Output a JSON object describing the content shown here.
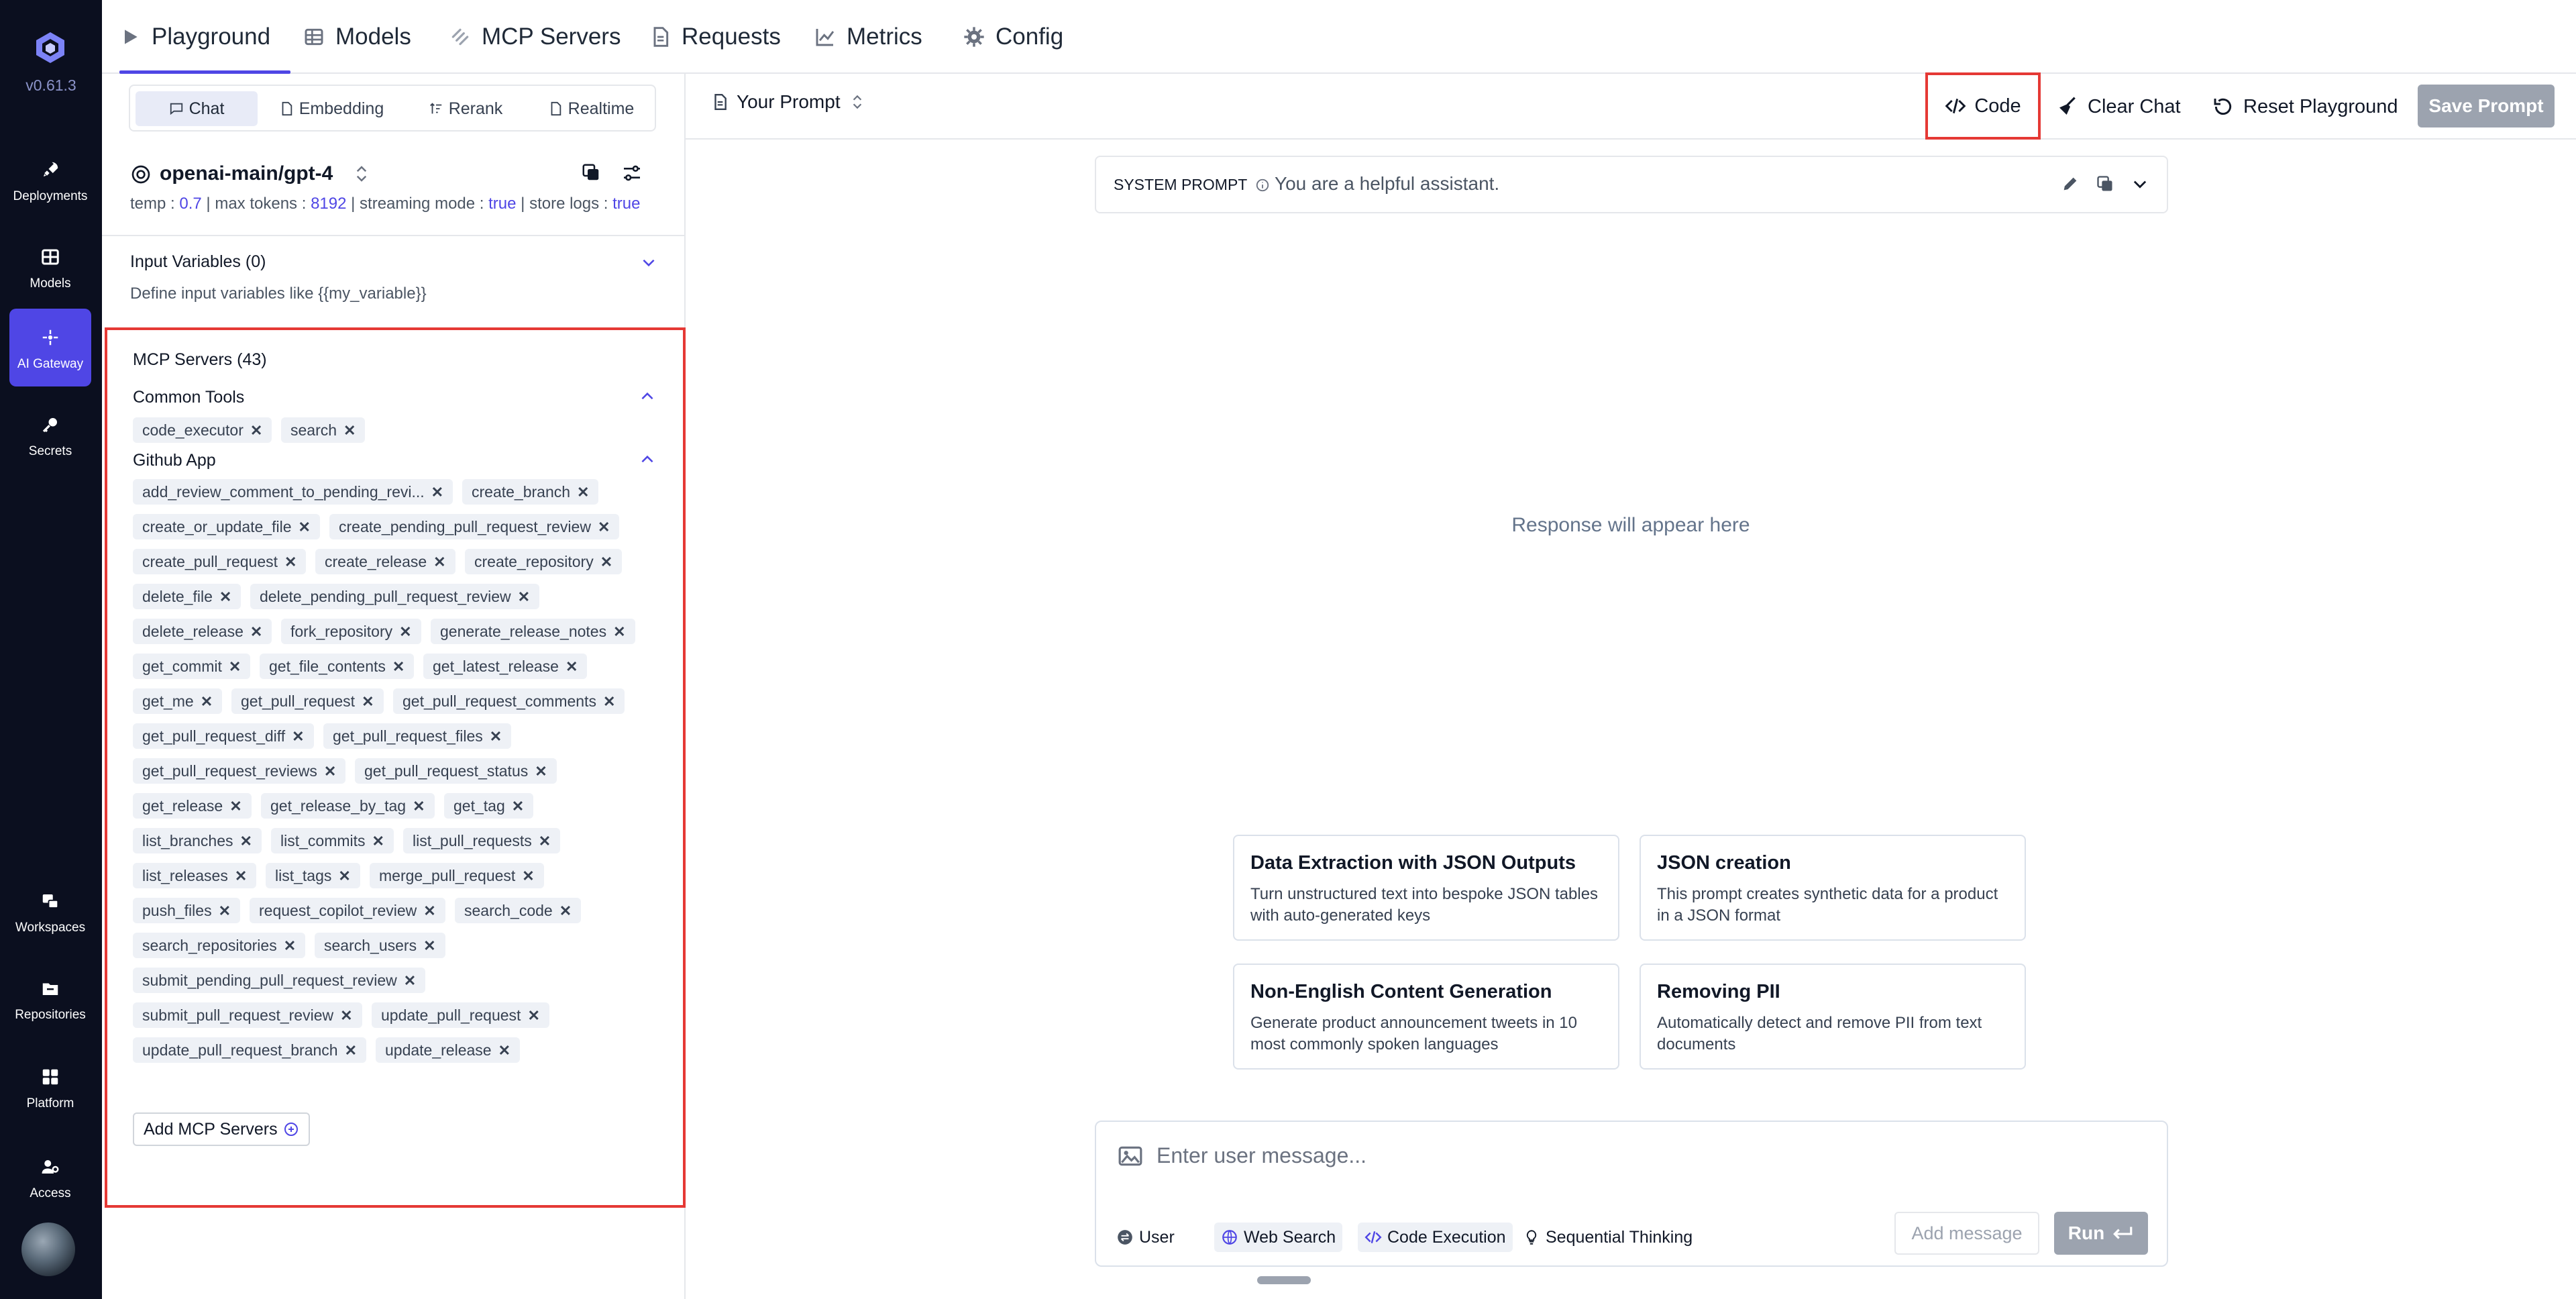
{
  "app": {
    "version": "v0.61.3"
  },
  "rail": {
    "items": [
      {
        "label": "Deployments",
        "icon": "rocket-icon"
      },
      {
        "label": "Models",
        "icon": "grid-icon"
      },
      {
        "label": "AI Gateway",
        "icon": "gateway-icon"
      },
      {
        "label": "Secrets",
        "icon": "key-icon"
      },
      {
        "label": "Workspaces",
        "icon": "workspaces-icon"
      },
      {
        "label": "Repositories",
        "icon": "folder-icon"
      },
      {
        "label": "Platform",
        "icon": "apps-icon"
      },
      {
        "label": "Access",
        "icon": "user-gear-icon"
      }
    ]
  },
  "topnav": {
    "tabs": [
      {
        "label": "Playground",
        "icon": "play-icon"
      },
      {
        "label": "Models",
        "icon": "table-icon"
      },
      {
        "label": "MCP Servers",
        "icon": "mcp-icon"
      },
      {
        "label": "Requests",
        "icon": "document-icon"
      },
      {
        "label": "Metrics",
        "icon": "chart-icon"
      },
      {
        "label": "Config",
        "icon": "gear-icon"
      }
    ],
    "active_color": "#4f46e5"
  },
  "modes": [
    "Chat",
    "Embedding",
    "Rerank",
    "Realtime"
  ],
  "model": {
    "name": "openai-main/gpt-4",
    "temp_label": "temp :",
    "temp": "0.7",
    "max_tokens_label": "max tokens :",
    "max_tokens": "8192",
    "streaming_label": "streaming mode :",
    "streaming": "true",
    "store_logs_label": "store logs :",
    "store_logs": "true"
  },
  "input_variables": {
    "title": "Input Variables (0)",
    "description": "Define input variables like {{my_variable}}"
  },
  "mcp": {
    "title": "MCP Servers (43)",
    "groups": [
      {
        "name": "Common Tools",
        "tools": [
          "code_executor",
          "search"
        ]
      },
      {
        "name": "Github App",
        "tools": [
          "add_review_comment_to_pending_revi...",
          "create_branch",
          "create_or_update_file",
          "create_pending_pull_request_review",
          "create_pull_request",
          "create_release",
          "create_repository",
          "delete_file",
          "delete_pending_pull_request_review",
          "delete_release",
          "fork_repository",
          "generate_release_notes",
          "get_commit",
          "get_file_contents",
          "get_latest_release",
          "get_me",
          "get_pull_request",
          "get_pull_request_comments",
          "get_pull_request_diff",
          "get_pull_request_files",
          "get_pull_request_reviews",
          "get_pull_request_status",
          "get_release",
          "get_release_by_tag",
          "get_tag",
          "list_branches",
          "list_commits",
          "list_pull_requests",
          "list_releases",
          "list_tags",
          "merge_pull_request",
          "push_files",
          "request_copilot_review",
          "search_code",
          "search_repositories",
          "search_users",
          "submit_pending_pull_request_review",
          "submit_pull_request_review",
          "update_pull_request",
          "update_pull_request_branch",
          "update_release"
        ]
      }
    ],
    "add_label": "Add MCP Servers"
  },
  "toolbar": {
    "prompt_label": "Your Prompt",
    "code_label": "Code",
    "clear_label": "Clear Chat",
    "reset_label": "Reset Playground",
    "save_label": "Save Prompt"
  },
  "system_prompt": {
    "label": "SYSTEM PROMPT",
    "text": "You are a helpful assistant."
  },
  "response_placeholder": "Response will appear here",
  "cards": [
    {
      "title": "Data Extraction with JSON Outputs",
      "desc": "Turn unstructured text into bespoke JSON tables with auto-generated keys"
    },
    {
      "title": "JSON creation",
      "desc": "This prompt creates synthetic data for a product in a JSON format"
    },
    {
      "title": "Non-English Content Generation",
      "desc": "Generate product announcement tweets in 10 most commonly spoken languages"
    },
    {
      "title": "Removing PII",
      "desc": "Automatically detect and remove PII from text documents"
    }
  ],
  "composer": {
    "placeholder": "Enter user message...",
    "role": "User",
    "tools": [
      "Web Search",
      "Code Execution",
      "Sequential Thinking"
    ],
    "add_message": "Add message",
    "run": "Run"
  }
}
